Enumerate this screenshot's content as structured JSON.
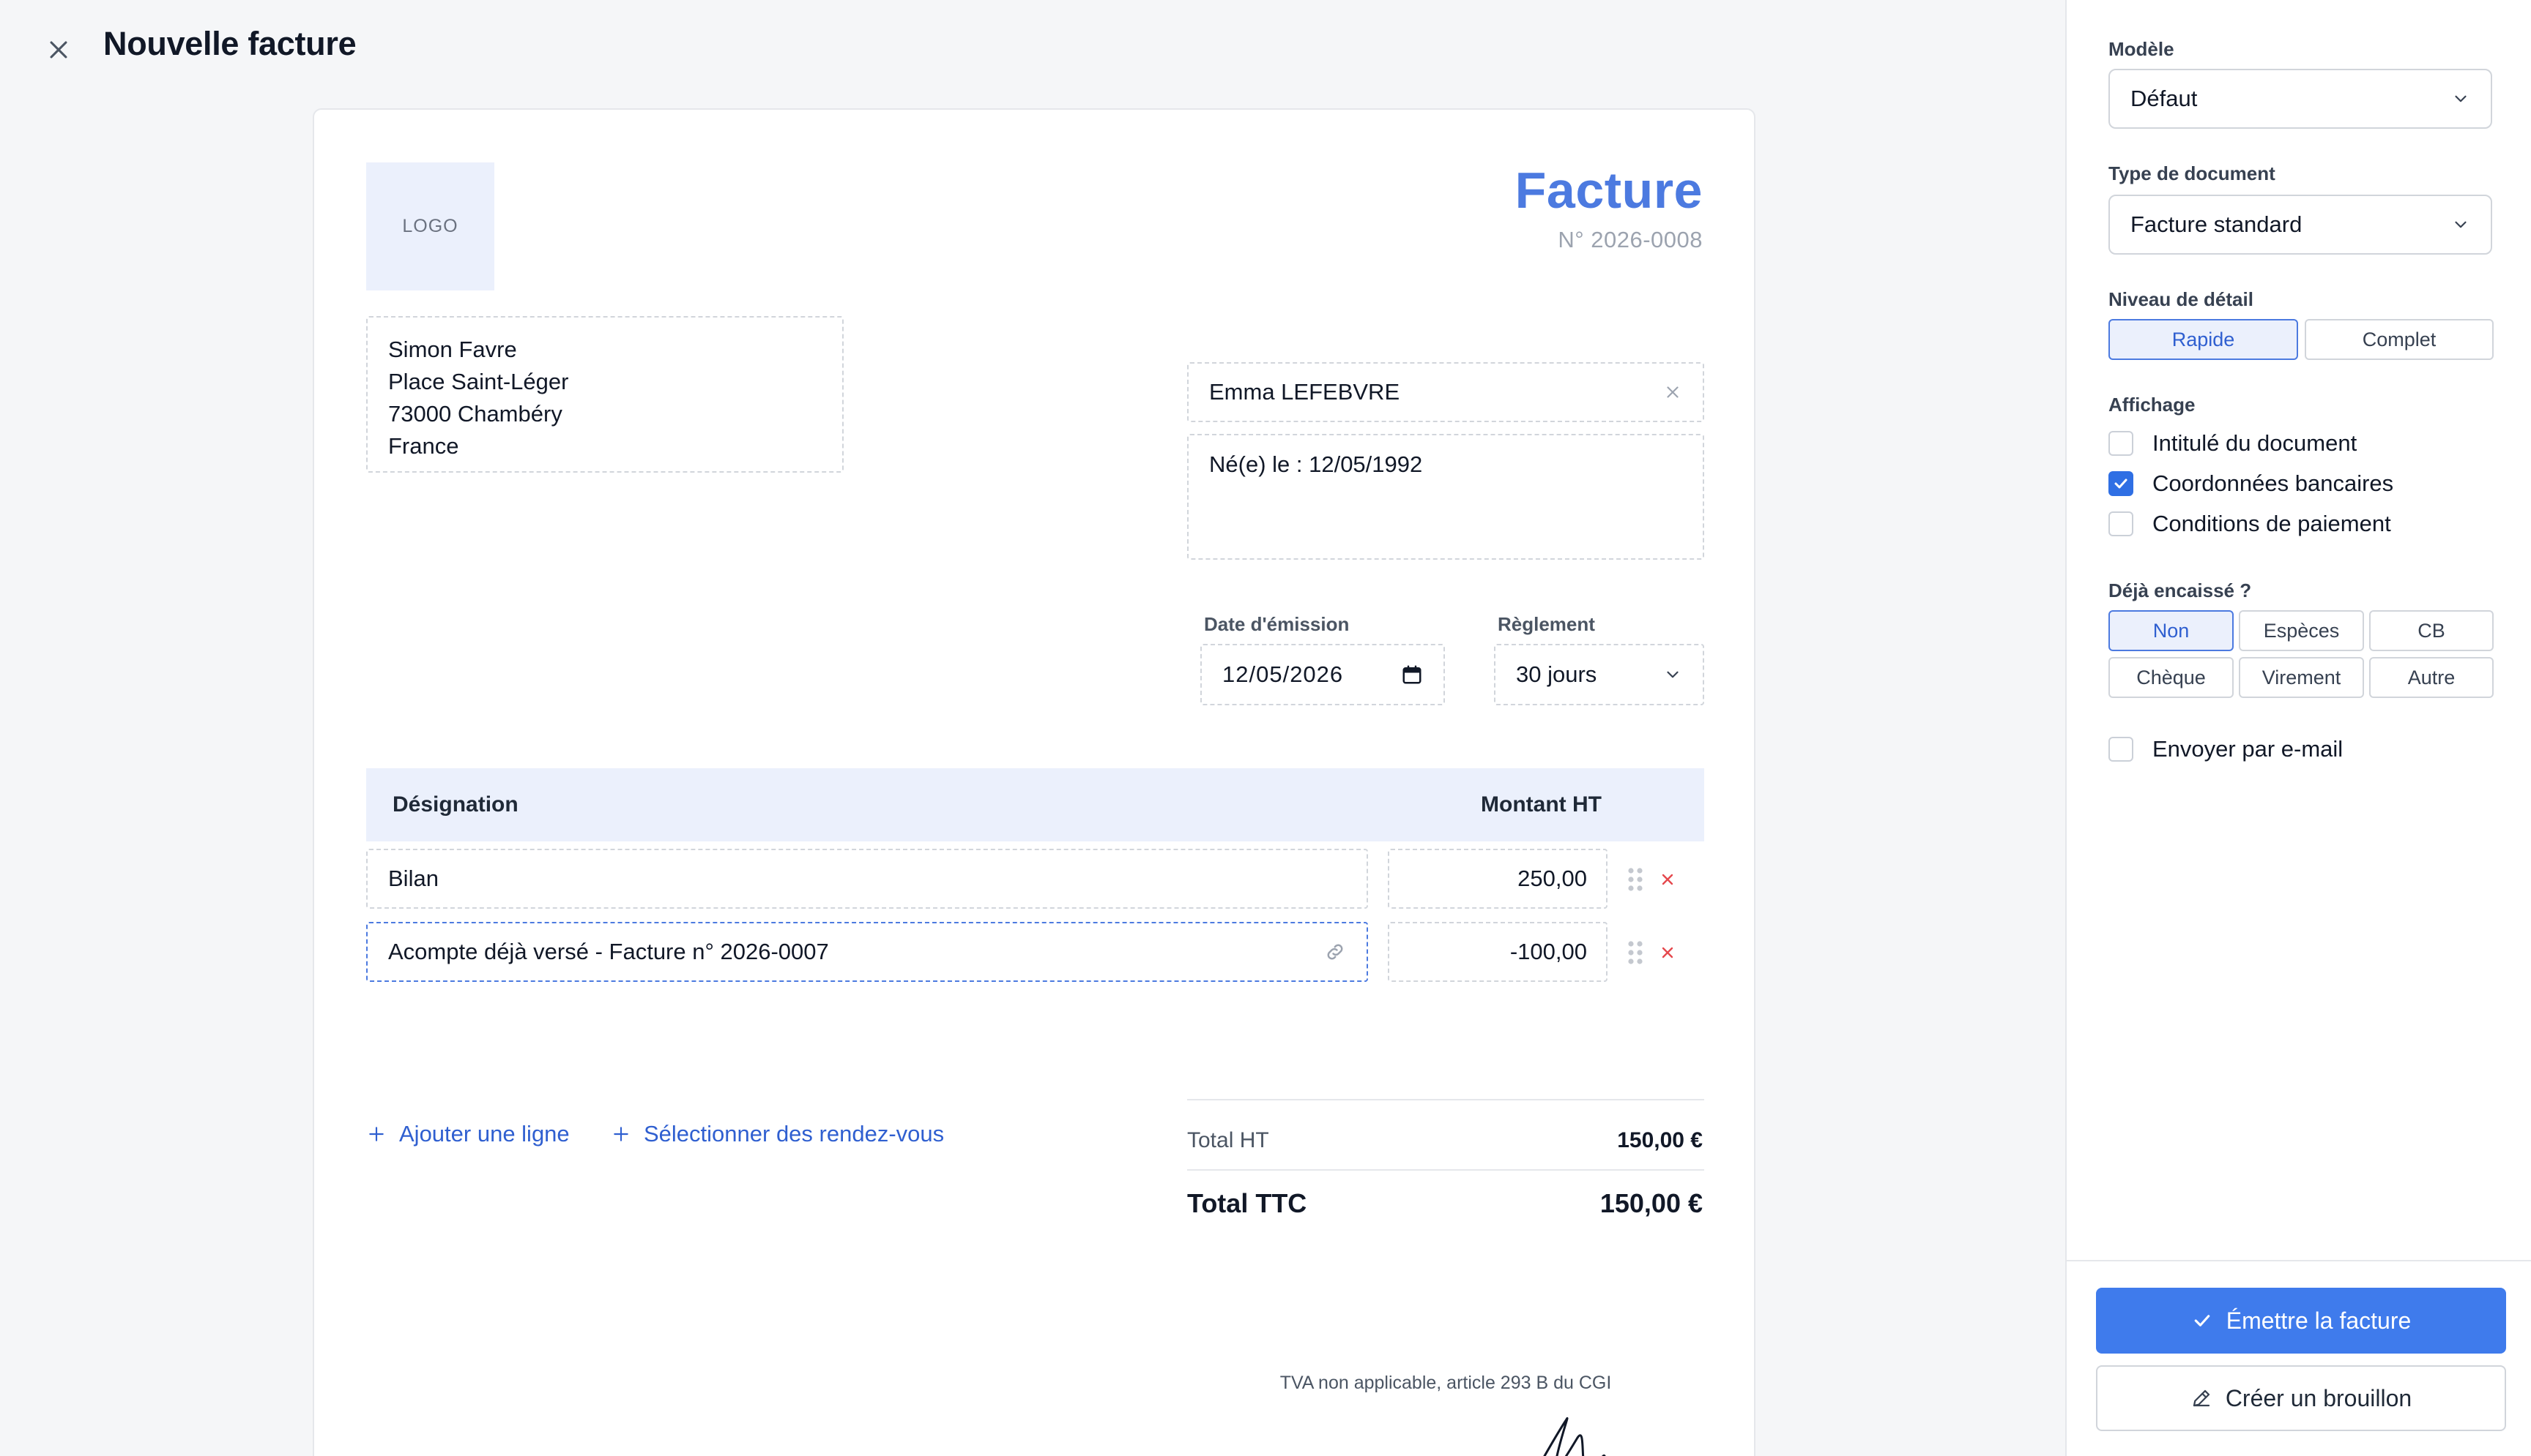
{
  "header": {
    "title": "Nouvelle facture",
    "close_icon": "close-icon"
  },
  "document": {
    "logo_text": "LOGO",
    "heading": "Facture",
    "number": "N° 2026-0008",
    "sender": {
      "line1": "Simon Favre",
      "line2": "Place Saint-Léger",
      "line3": "73000 Chambéry",
      "line4": "France"
    },
    "client": {
      "name": "Emma LEFEBVRE",
      "extra": "Né(e) le : 12/05/1992"
    },
    "date_label": "Date d'émission",
    "date_value": "12/05/2026",
    "payment_label": "Règlement",
    "payment_value": "30 jours",
    "table": {
      "col_designation": "Désignation",
      "col_amount": "Montant HT",
      "rows": [
        {
          "designation": "Bilan",
          "amount": "250,00"
        },
        {
          "designation": "Acompte déjà versé - Facture n° 2026-0007",
          "amount": "-100,00"
        }
      ]
    },
    "add_line": "Ajouter une ligne",
    "select_appointments": "Sélectionner des rendez-vous",
    "totals": {
      "ht_label": "Total HT",
      "ht_value": "150,00 €",
      "ttc_label": "Total TTC",
      "ttc_value": "150,00 €"
    },
    "tva_note": "TVA non applicable, article 293 B du CGI"
  },
  "panel": {
    "model_label": "Modèle",
    "model_value": "Défaut",
    "doc_type_label": "Type de document",
    "doc_type_value": "Facture standard",
    "detail_label": "Niveau de détail",
    "detail_options": [
      "Rapide",
      "Complet"
    ],
    "detail_selected": "Rapide",
    "display_label": "Affichage",
    "display_options": [
      {
        "label": "Intitulé du document",
        "checked": false
      },
      {
        "label": "Coordonnées bancaires",
        "checked": true
      },
      {
        "label": "Conditions de paiement",
        "checked": false
      }
    ],
    "cashed_label": "Déjà encaissé ?",
    "cashed_options": [
      "Non",
      "Espèces",
      "CB",
      "Chèque",
      "Virement",
      "Autre"
    ],
    "cashed_selected": "Non",
    "send_email_label": "Envoyer par e-mail",
    "send_email_checked": false,
    "issue_button": "Émettre la facture",
    "draft_button": "Créer un brouillon"
  },
  "colors": {
    "accent": "#3f7bec",
    "heading_blue": "#4c7ae0",
    "link_blue": "#2f5fd0",
    "delete_red": "#e5484d",
    "table_head_bg": "#ebf0fc"
  }
}
